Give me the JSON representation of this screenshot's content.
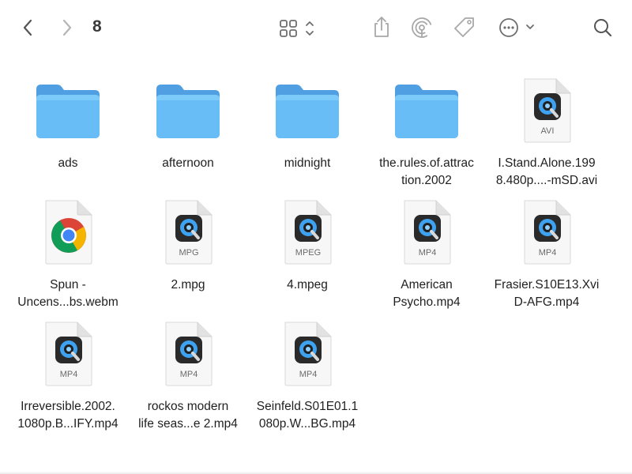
{
  "toolbar": {
    "title": "8",
    "back_icon": "chevron-left-icon",
    "forward_icon": "chevron-right-icon",
    "view_icon": "grid-view-icon",
    "share_icon": "share-icon",
    "airdrop_icon": "airdrop-icon",
    "tag_icon": "tag-icon",
    "more_icon": "ellipsis-circle-icon",
    "search_icon": "search-icon"
  },
  "colors": {
    "folder_back": "#5aa6e6",
    "folder_front": "#6cc0f7",
    "quicktime_blue": "#3ea2f0",
    "toolbar_icon": "#6e6e6e"
  },
  "items": [
    {
      "name": "ads",
      "kind": "folder"
    },
    {
      "name": "afternoon",
      "kind": "folder"
    },
    {
      "name": "midnight",
      "kind": "folder"
    },
    {
      "name": "the.rules.of.attrac\ntion.2002",
      "kind": "folder"
    },
    {
      "name": "I.Stand.Alone.199\n8.480p....-mSD.avi",
      "kind": "video",
      "ext": "AVI"
    },
    {
      "name": "Spun -\nUncens...bs.webm",
      "kind": "chrome"
    },
    {
      "name": "2.mpg",
      "kind": "video",
      "ext": "MPG"
    },
    {
      "name": "4.mpeg",
      "kind": "video",
      "ext": "MPEG"
    },
    {
      "name": "American\nPsycho.mp4",
      "kind": "video",
      "ext": "MP4"
    },
    {
      "name": "Frasier.S10E13.Xvi\nD-AFG.mp4",
      "kind": "video",
      "ext": "MP4"
    },
    {
      "name": "Irreversible.2002.\n1080p.B...IFY.mp4",
      "kind": "video",
      "ext": "MP4"
    },
    {
      "name": "rockos modern\nlife seas...e 2.mp4",
      "kind": "video",
      "ext": "MP4"
    },
    {
      "name": "Seinfeld.S01E01.1\n080p.W...BG.mp4",
      "kind": "video",
      "ext": "MP4"
    }
  ]
}
